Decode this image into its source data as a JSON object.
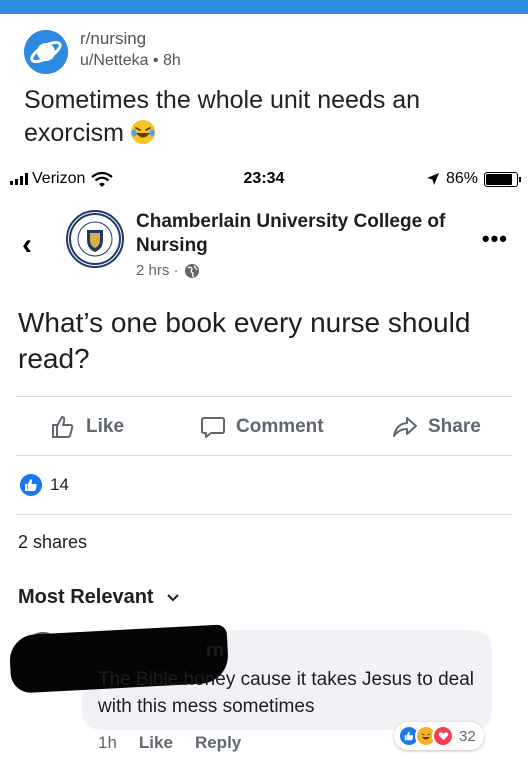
{
  "reddit": {
    "subreddit": "r/nursing",
    "user_time": "u/Netteka • 8h",
    "title": "Sometimes the whole unit needs an exorcism"
  },
  "status_bar": {
    "carrier": "Verizon",
    "time": "23:34",
    "battery": "86%",
    "battery_level": 0.86
  },
  "post": {
    "page_name": "Chamberlain University College of Nursing",
    "time": "2 hrs ·",
    "text": "What’s one book every nurse should read?",
    "more": "•••"
  },
  "actions": {
    "like": "Like",
    "comment": "Comment",
    "share": "Share"
  },
  "reactions": {
    "count": "14"
  },
  "shares": "2 shares",
  "filter": "Most Relevant",
  "comment": {
    "name_visible": "rn",
    "text": "The Bible honey cause it takes Jesus to deal with this mess sometimes",
    "time": "1h",
    "like": "Like",
    "reply": "Reply",
    "reaction_count": "32"
  },
  "colors": {
    "facebook_blue": "#1877f2",
    "reddit_top": "#2f8fe3",
    "love_red": "#f33e58",
    "haha_yellow": "#f7b125"
  }
}
